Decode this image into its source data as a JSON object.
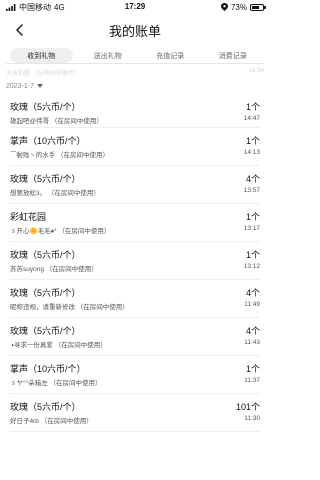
{
  "status_bar": {
    "carrier": "中国移动",
    "network": "4G",
    "time": "17:29",
    "battery": "73%",
    "battery_level": 0.73
  },
  "header": {
    "title": "我的账单"
  },
  "tabs": [
    {
      "label": "收到礼物",
      "active": true
    },
    {
      "label": "送出礼物",
      "active": false
    },
    {
      "label": "充值记录",
      "active": false
    },
    {
      "label": "消费记录",
      "active": false
    }
  ],
  "ghost": {
    "left": "大吉和肥    （在房间中使用）",
    "right": "14:54"
  },
  "date_filter": {
    "label": "2023-1-7"
  },
  "items": [
    {
      "name": "玫瑰（5六币/个）",
      "sub": "雄起吧@伟哥    （在房间中使用）",
      "qty": "1个",
      "time": "14:47"
    },
    {
      "name": "掌声（10六币/个）",
      "sub": "⏜剩残丶的水手    （在房间中使用）",
      "qty": "1个",
      "time": "14:13"
    },
    {
      "name": "玫瑰（5六币/个）",
      "sub": "想要放松3。    （在房间中使用）",
      "qty": "4个",
      "time": "13:57"
    },
    {
      "name": "彩虹花园",
      "sub": "ゞ开心🌼毛毛♠*    （在房间中使用）",
      "qty": "1个",
      "time": "13:17"
    },
    {
      "name": "玫瑰（5六币/个）",
      "sub": "苏苏suyong    （在房间中使用）",
      "qty": "1个",
      "time": "13:12"
    },
    {
      "name": "玫瑰（5六币/个）",
      "sub": "昵称违规，请重新修改    （在房间中使用）",
      "qty": "4个",
      "time": "11:49"
    },
    {
      "name": "玫瑰（5六币/个）",
      "sub": "◑寻求一份真爱    （在房间中使用）",
      "qty": "4个",
      "time": "11:43"
    },
    {
      "name": "掌声（10六币/个）",
      "sub": "ゞヤ°°朵箱左    （在房间中使用）",
      "qty": "1个",
      "time": "11:37"
    },
    {
      "name": "玫瑰（5六币/个）",
      "sub": "好日子4rb    （在房间中使用）",
      "qty": "101个",
      "time": "11:30"
    }
  ]
}
